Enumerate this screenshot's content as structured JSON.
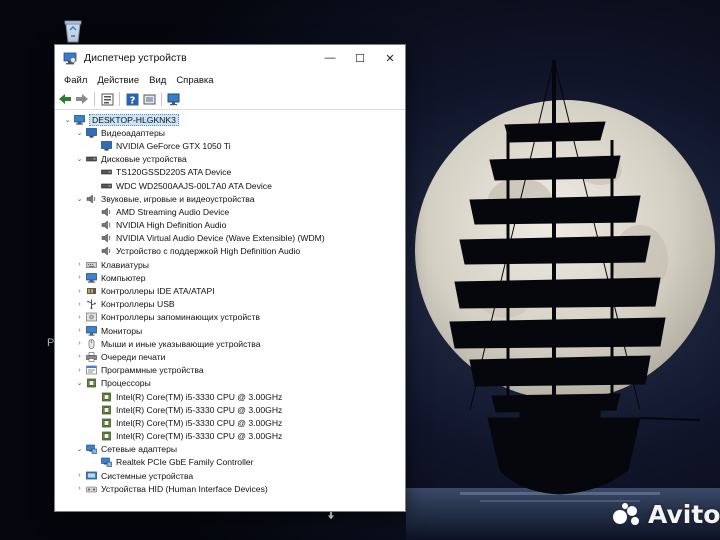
{
  "window": {
    "title": "Диспетчер устройств",
    "controls": {
      "minimize": "—",
      "maximize": "☐",
      "close": "✕"
    }
  },
  "menu": [
    "Файл",
    "Действие",
    "Вид",
    "Справка"
  ],
  "toolbar": [
    "back-icon",
    "forward-icon",
    "properties-icon",
    "help-icon",
    "update-driver-icon",
    "scan-hardware-icon"
  ],
  "tree": {
    "root": "DESKTOP-HLGKNK3",
    "categories": [
      {
        "label": "Видеоадаптеры",
        "icon": "display-adapter-icon",
        "expanded": true,
        "children": [
          {
            "label": "NVIDIA GeForce GTX 1050 Ti",
            "icon": "display-adapter-icon"
          }
        ]
      },
      {
        "label": "Дисковые устройства",
        "icon": "disk-drive-icon",
        "expanded": true,
        "children": [
          {
            "label": "TS120GSSD220S ATA Device",
            "icon": "disk-drive-icon"
          },
          {
            "label": "WDC WD2500AAJS-00L7A0 ATA Device",
            "icon": "disk-drive-icon"
          }
        ]
      },
      {
        "label": "Звуковые, игровые и видеоустройства",
        "icon": "speaker-icon",
        "expanded": true,
        "children": [
          {
            "label": "AMD Streaming Audio Device",
            "icon": "speaker-icon"
          },
          {
            "label": "NVIDIA High Definition Audio",
            "icon": "speaker-icon"
          },
          {
            "label": "NVIDIA Virtual Audio Device (Wave Extensible) (WDM)",
            "icon": "speaker-icon"
          },
          {
            "label": "Устройство с поддержкой High Definition Audio",
            "icon": "speaker-icon"
          }
        ]
      },
      {
        "label": "Клавиатуры",
        "icon": "keyboard-icon",
        "expanded": false,
        "children": []
      },
      {
        "label": "Компьютер",
        "icon": "computer-icon",
        "expanded": false,
        "children": []
      },
      {
        "label": "Контроллеры IDE ATA/ATAPI",
        "icon": "ide-controller-icon",
        "expanded": false,
        "children": []
      },
      {
        "label": "Контроллеры USB",
        "icon": "usb-icon",
        "expanded": false,
        "children": []
      },
      {
        "label": "Контроллеры запоминающих устройств",
        "icon": "storage-controller-icon",
        "expanded": false,
        "children": []
      },
      {
        "label": "Мониторы",
        "icon": "monitor-icon",
        "expanded": false,
        "children": []
      },
      {
        "label": "Мыши и иные указывающие устройства",
        "icon": "mouse-icon",
        "expanded": false,
        "children": []
      },
      {
        "label": "Очереди печати",
        "icon": "printer-icon",
        "expanded": false,
        "children": []
      },
      {
        "label": "Программные устройства",
        "icon": "software-device-icon",
        "expanded": false,
        "children": []
      },
      {
        "label": "Процессоры",
        "icon": "processor-icon",
        "expanded": true,
        "children": [
          {
            "label": "Intel(R) Core(TM) i5-3330 CPU @ 3.00GHz",
            "icon": "processor-icon"
          },
          {
            "label": "Intel(R) Core(TM) i5-3330 CPU @ 3.00GHz",
            "icon": "processor-icon"
          },
          {
            "label": "Intel(R) Core(TM) i5-3330 CPU @ 3.00GHz",
            "icon": "processor-icon"
          },
          {
            "label": "Intel(R) Core(TM) i5-3330 CPU @ 3.00GHz",
            "icon": "processor-icon"
          }
        ]
      },
      {
        "label": "Сетевые адаптеры",
        "icon": "network-adapter-icon",
        "expanded": true,
        "children": [
          {
            "label": "Realtek PCIe GbE Family Controller",
            "icon": "network-adapter-icon"
          }
        ]
      },
      {
        "label": "Системные устройства",
        "icon": "system-device-icon",
        "expanded": false,
        "children": []
      },
      {
        "label": "Устройства HID (Human Interface Devices)",
        "icon": "hid-icon",
        "expanded": false,
        "children": []
      }
    ]
  },
  "desktop": {
    "icons": [
      "recycle-bin-icon"
    ],
    "edge_letter": "P",
    "watermark": "Avito"
  },
  "colors": {
    "selection": "#cde4f7",
    "accent": "#1f6fb8",
    "moon": "#d9d4c8",
    "sky": "#0a0d1a"
  }
}
